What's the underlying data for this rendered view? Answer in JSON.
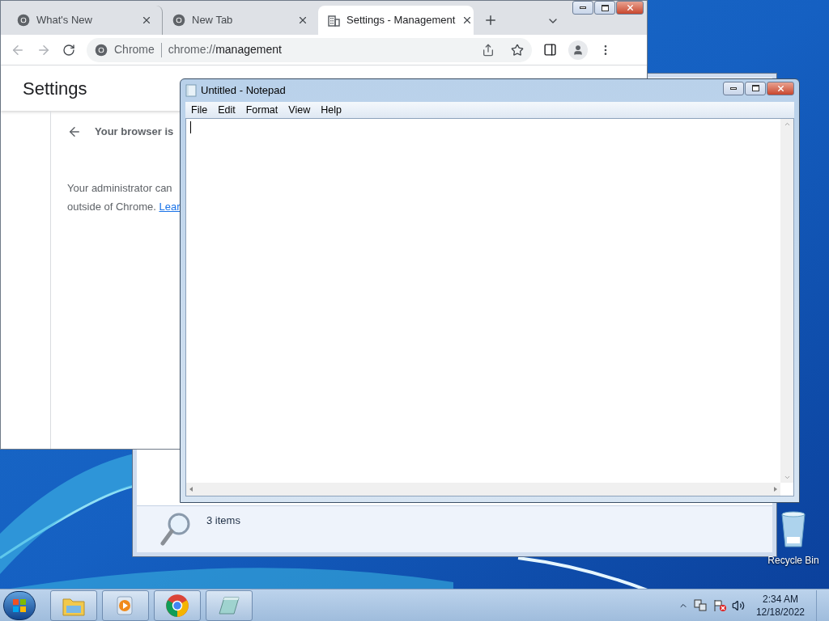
{
  "chrome": {
    "tabs": [
      {
        "title": "What's New",
        "selected": false,
        "kind": "chrome"
      },
      {
        "title": "New Tab",
        "selected": false,
        "kind": "chrome"
      },
      {
        "title": "Settings - Management",
        "selected": true,
        "kind": "building"
      }
    ],
    "omnibox": {
      "chip": "Chrome",
      "url_scheme": "chrome://",
      "url_path": "management"
    },
    "page": {
      "title": "Settings",
      "heading": "Your browser is",
      "body_line_1": "Your administrator can",
      "body_line_2": "outside of Chrome.",
      "link": "Lear"
    }
  },
  "notepad": {
    "title": "Untitled - Notepad",
    "menu": [
      "File",
      "Edit",
      "Format",
      "View",
      "Help"
    ]
  },
  "explorer": {
    "status": "3 items"
  },
  "desktop_icons": [
    {
      "label": "Recycle Bin"
    }
  ],
  "taskbar": {
    "buttons": [
      {
        "kind": "explorer"
      },
      {
        "kind": "media"
      },
      {
        "kind": "chrome"
      },
      {
        "kind": "notepad"
      }
    ],
    "clock": {
      "time": "2:34 AM",
      "date": "12/18/2022"
    }
  }
}
